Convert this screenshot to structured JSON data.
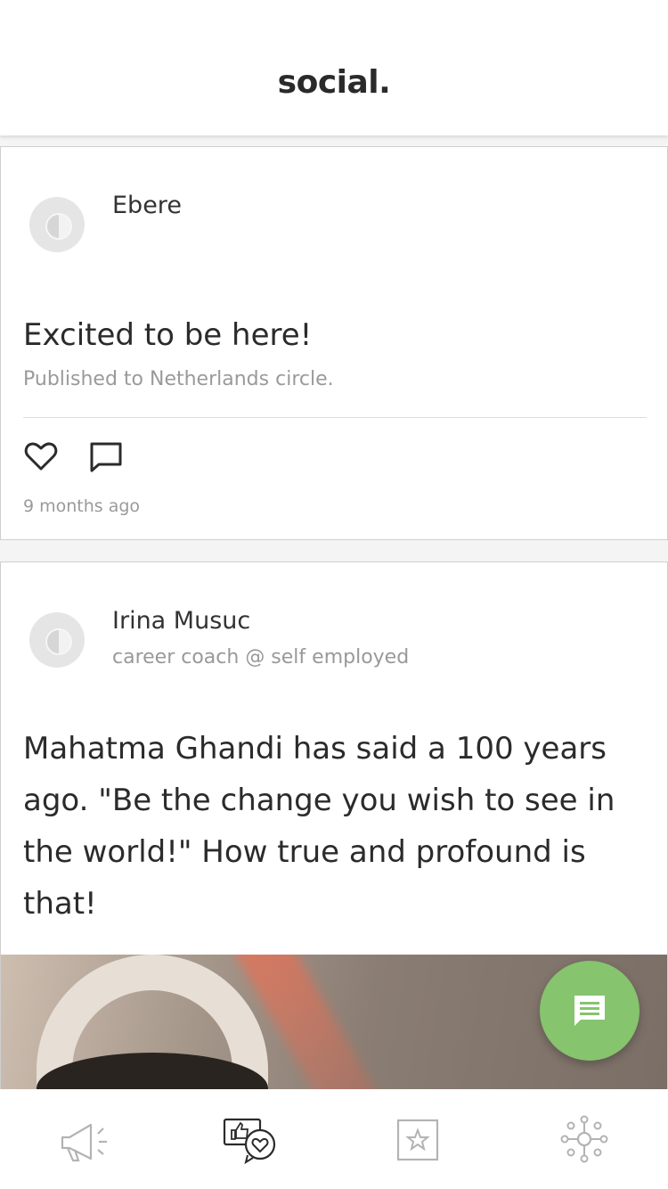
{
  "header": {
    "title": "social."
  },
  "icons": {
    "battery": "battery-icon",
    "heart": "heart-icon",
    "comment": "comment-icon",
    "fab": "message-icon",
    "nav_announce": "megaphone-icon",
    "nav_social": "social-like-icon",
    "nav_favorites": "star-icon",
    "nav_network": "network-icon"
  },
  "colors": {
    "accent_green": "#86c46e",
    "battery_yellow": "#f7d54a"
  },
  "posts": [
    {
      "author": "Ebere",
      "text": "Excited to be here!",
      "published_prefix": "Published to",
      "circle": "Netherlands",
      "published_suffix": "circle.",
      "time": "9 months ago"
    },
    {
      "author": "Irina Musuc",
      "subtitle": "career coach @ self employed",
      "text": "Mahatma Ghandi has said a 100 years ago. \"Be the change you wish to see in the world!\" How true and profound is that!"
    }
  ]
}
